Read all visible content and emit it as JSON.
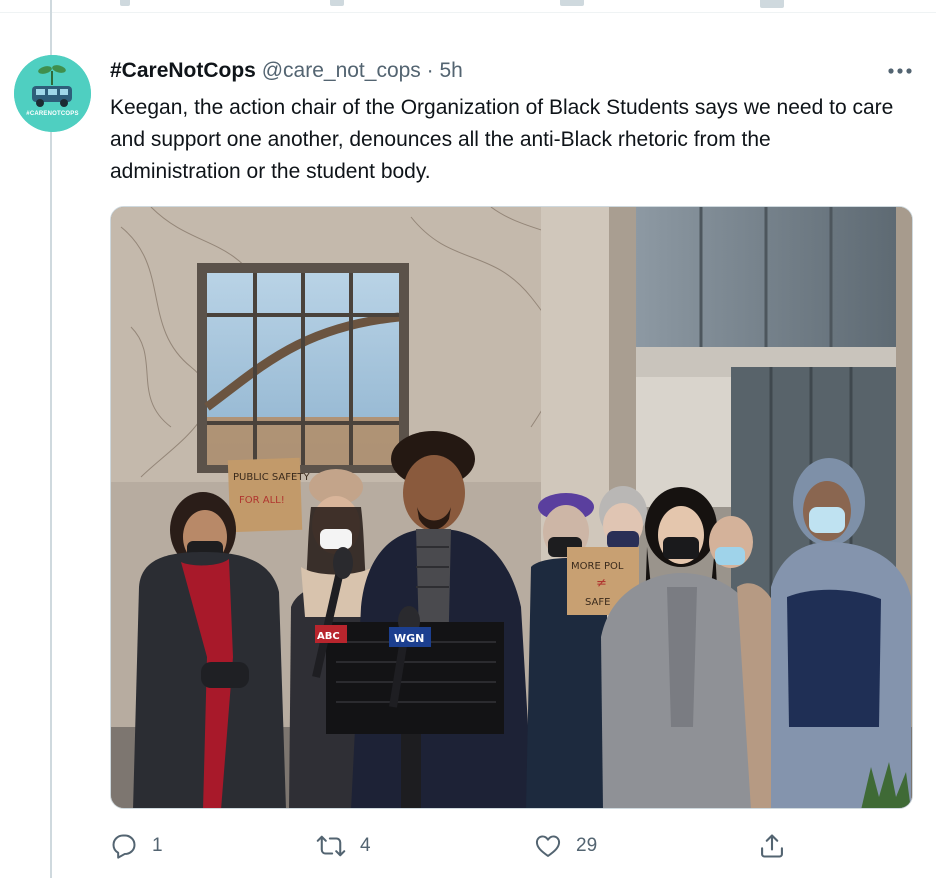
{
  "tweet": {
    "display_name": "#CareNotCops",
    "handle": "@care_not_cops",
    "separator": "·",
    "time": "5h",
    "text": "Keegan, the action chair of the Organization of Black Students says we need to care and support one another, denounces all the anti-Black rhetoric from the administration or the student body.",
    "avatar_label": "#CARENOTCOPS",
    "avatar_bg": "#4fcfc1"
  },
  "media": {
    "sign_left_line1": "PUBLIC SAFETY",
    "sign_left_line2": "FOR ALL!",
    "sign_right_line1": "MORE POL",
    "sign_right_line2": "≠",
    "sign_right_line3": "SAFE",
    "mic_flag_1": "WGN",
    "mic_flag_2": "ABC"
  },
  "actions": {
    "reply_count": "1",
    "retweet_count": "4",
    "like_count": "29",
    "reply_icon": "reply-icon",
    "retweet_icon": "retweet-icon",
    "like_icon": "heart-icon",
    "share_icon": "share-icon"
  },
  "colors": {
    "text_primary": "#0f1419",
    "text_secondary": "#536471",
    "border": "#cfd9de"
  }
}
